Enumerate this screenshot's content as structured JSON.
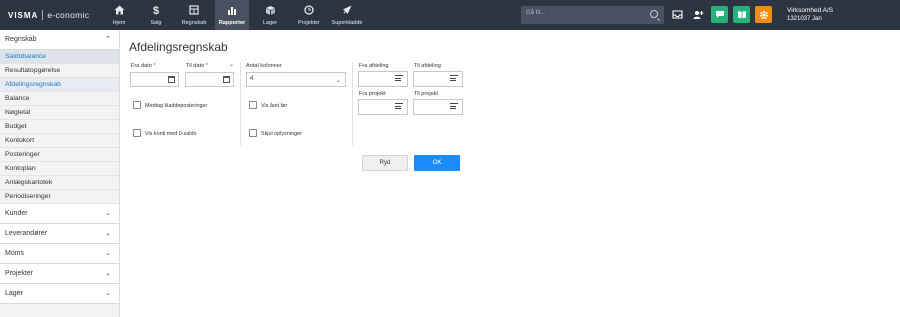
{
  "topbar": {
    "brand": "VISMA",
    "product": "e-conomic",
    "nav": [
      {
        "label": "Hjem",
        "icon": "home-icon"
      },
      {
        "label": "Salg",
        "icon": "dollar-icon"
      },
      {
        "label": "Regnskab",
        "icon": "ledger-icon"
      },
      {
        "label": "Rapporter",
        "icon": "bar-chart-icon",
        "active": true
      },
      {
        "label": "Lager",
        "icon": "box-icon"
      },
      {
        "label": "Projekter",
        "icon": "clock-icon"
      },
      {
        "label": "Superkladde",
        "icon": "rocket-icon"
      }
    ],
    "search_placeholder": "Gå til...",
    "company_name": "Virksomhed A/S",
    "company_user": "1321037 Jan"
  },
  "sidebar": {
    "regnskab_label": "Regnskab",
    "items": [
      "Saldobalance",
      "Resultatopgørelse",
      "Afdelingsregnskab",
      "Balance",
      "Nøgletal",
      "Budget",
      "Kontokort",
      "Posteringer",
      "Kontoplan",
      "Anlægskartotek",
      "Periodiseringer"
    ],
    "sections": [
      "Kunder",
      "Leverandører",
      "Moms",
      "Projekter",
      "Lager"
    ]
  },
  "form": {
    "title": "Afdelingsregnskab",
    "fra_dato_label": "Fra dato",
    "til_dato_label": "Til dato",
    "required_mark": "*",
    "antal_kolonner_label": "Antal kolonner",
    "antal_kolonner_value": "4",
    "fra_afdeling_label": "Fra afdeling",
    "til_afdeling_label": "Til afdeling",
    "fra_projekt_label": "Fra projekt",
    "til_projekt_label": "Til projekt",
    "medtag_label": "Medtag kladdeposteringer",
    "vis_aaret_label": "Vis året før",
    "vis_konti_label": "Vis konti med 0-saldo",
    "skjul_label": "Skjul oplysninger",
    "ryd_label": "Ryd",
    "ok_label": "OK"
  },
  "colors": {
    "topbar": "#2e3542",
    "accent_link": "#1f7acb",
    "ok_button": "#1a8cff",
    "green_button": "#26b37a",
    "orange_button": "#f28a16"
  }
}
